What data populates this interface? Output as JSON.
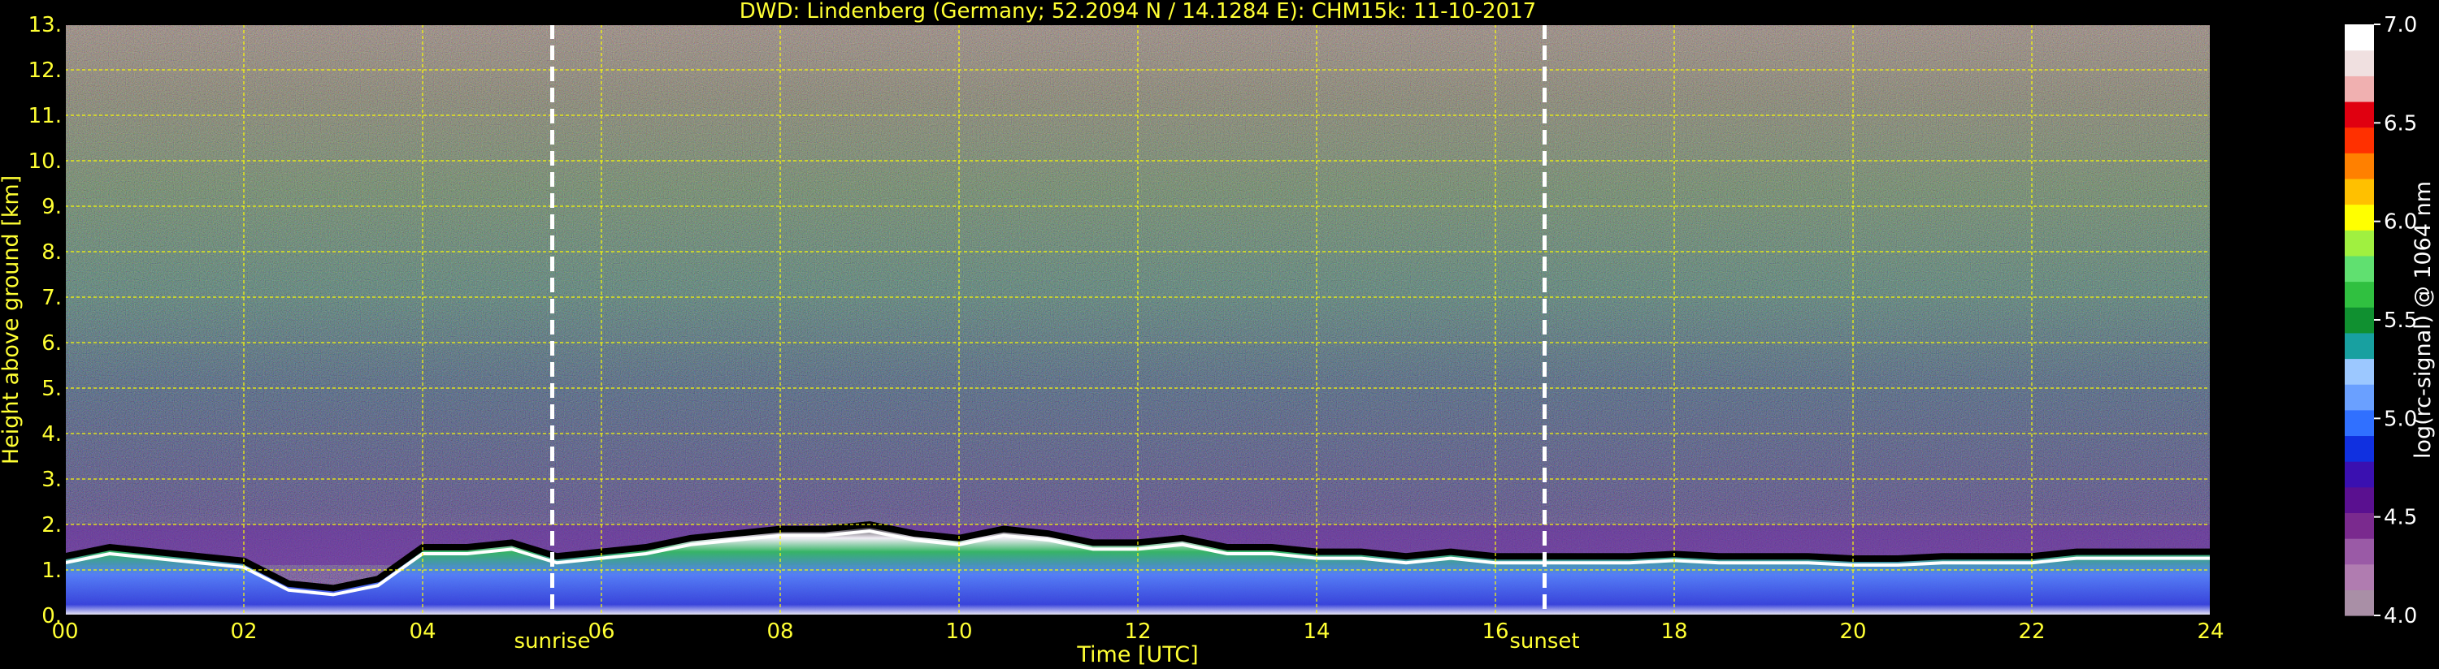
{
  "chart_data": {
    "type": "heatmap",
    "title": "DWD: Lindenberg (Germany; 52.2094 N / 14.1284 E):    CHM15k: 11-10-2017",
    "xlabel": "Time [UTC]",
    "ylabel": "Height above ground [km]",
    "xlim": [
      0,
      24
    ],
    "ylim": [
      0,
      13
    ],
    "x_ticks": [
      0,
      2,
      4,
      6,
      8,
      10,
      12,
      14,
      16,
      18,
      20,
      22,
      24
    ],
    "x_tick_labels": [
      "00",
      "02",
      "04",
      "06",
      "08",
      "10",
      "12",
      "14",
      "16",
      "18",
      "20",
      "22",
      "24"
    ],
    "y_ticks": [
      0,
      1,
      2,
      3,
      4,
      5,
      6,
      7,
      8,
      9,
      10,
      11,
      12,
      13
    ],
    "y_tick_labels": [
      "0.",
      "1.",
      "2.",
      "3.",
      "4.",
      "5.",
      "6.",
      "7.",
      "8.",
      "9.",
      "10.",
      "11.",
      "12.",
      "13."
    ],
    "grid": true,
    "grid_color": "#ffff00",
    "annotations": [
      {
        "label": "sunrise",
        "x": 5.45
      },
      {
        "label": "sunset",
        "x": 16.55
      }
    ],
    "boundary_layer_top_km": [
      [
        0,
        1.3
      ],
      [
        0.5,
        1.5
      ],
      [
        1.0,
        1.4
      ],
      [
        1.5,
        1.3
      ],
      [
        2.0,
        1.2
      ],
      [
        2.5,
        0.7
      ],
      [
        3.0,
        0.6
      ],
      [
        3.5,
        0.8
      ],
      [
        4.0,
        1.5
      ],
      [
        4.5,
        1.5
      ],
      [
        5.0,
        1.6
      ],
      [
        5.5,
        1.3
      ],
      [
        6.0,
        1.4
      ],
      [
        6.5,
        1.5
      ],
      [
        7.0,
        1.7
      ],
      [
        7.5,
        1.8
      ],
      [
        8.0,
        1.9
      ],
      [
        8.5,
        1.9
      ],
      [
        9.0,
        2.0
      ],
      [
        9.5,
        1.8
      ],
      [
        10.0,
        1.7
      ],
      [
        10.5,
        1.9
      ],
      [
        11.0,
        1.8
      ],
      [
        11.5,
        1.6
      ],
      [
        12.0,
        1.6
      ],
      [
        12.5,
        1.7
      ],
      [
        13.0,
        1.5
      ],
      [
        13.5,
        1.5
      ],
      [
        14.0,
        1.4
      ],
      [
        14.5,
        1.4
      ],
      [
        15.0,
        1.3
      ],
      [
        15.5,
        1.4
      ],
      [
        16.0,
        1.3
      ],
      [
        16.5,
        1.3
      ],
      [
        17.0,
        1.3
      ],
      [
        17.5,
        1.3
      ],
      [
        18.0,
        1.35
      ],
      [
        18.5,
        1.3
      ],
      [
        19.0,
        1.3
      ],
      [
        19.5,
        1.3
      ],
      [
        20.0,
        1.25
      ],
      [
        20.5,
        1.25
      ],
      [
        21.0,
        1.3
      ],
      [
        21.5,
        1.3
      ],
      [
        22.0,
        1.3
      ],
      [
        22.5,
        1.4
      ],
      [
        23.0,
        1.4
      ],
      [
        23.5,
        1.4
      ],
      [
        24.0,
        1.4
      ]
    ],
    "colorbar": {
      "label": "log(rc-signal) @ 1064 nm",
      "range": [
        4.0,
        7.0
      ],
      "ticks": [
        4.0,
        4.5,
        5.0,
        5.5,
        6.0,
        6.5,
        7.0
      ],
      "tick_labels": [
        "4.0",
        "4.5",
        "5.0",
        "5.5",
        "6.0",
        "6.5",
        "7.0"
      ],
      "colors": [
        "#a98fa6",
        "#b07cb0",
        "#9a5aa6",
        "#7a2a8e",
        "#5a1090",
        "#3a10b0",
        "#1030e0",
        "#3070ff",
        "#6aa0ff",
        "#9cc8ff",
        "#18a0a0",
        "#109030",
        "#30c040",
        "#60e070",
        "#a0f040",
        "#ffff00",
        "#ffc000",
        "#ff8000",
        "#ff3000",
        "#e00010",
        "#f0b0b0",
        "#f0e0e0",
        "#ffffff"
      ]
    }
  }
}
